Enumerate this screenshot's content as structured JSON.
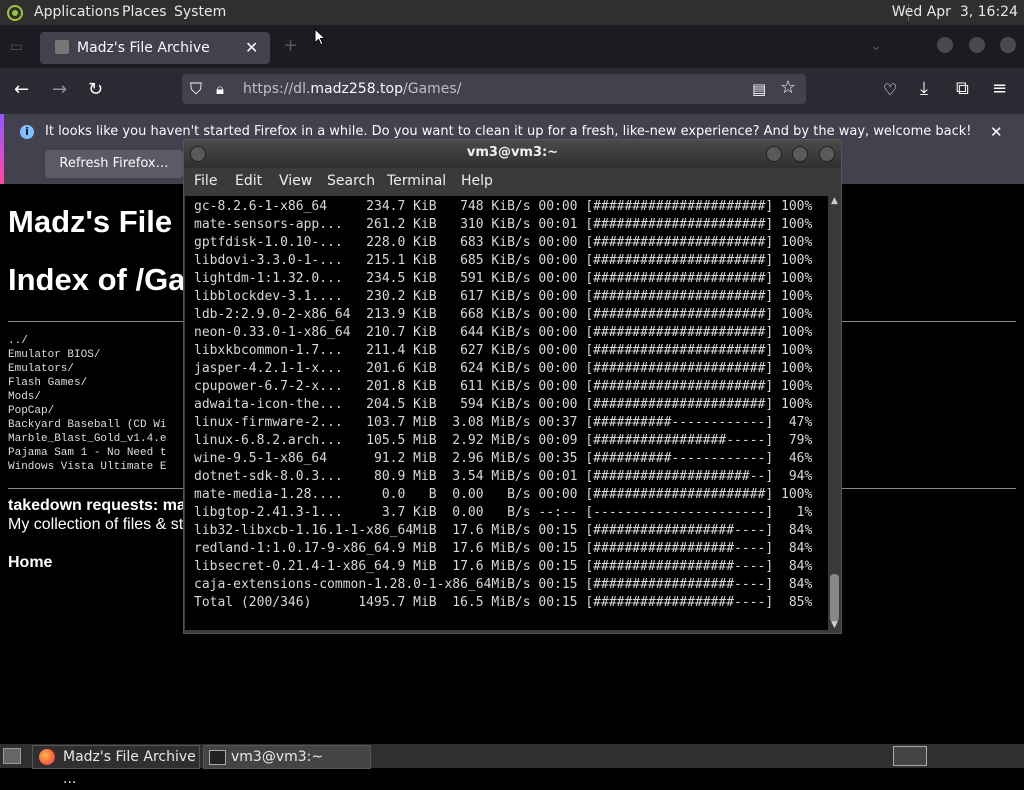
{
  "top_panel": {
    "menus": [
      "Applications",
      "Places",
      "System"
    ],
    "clock": "Wed Apr  3, 16:24"
  },
  "firefox": {
    "tab_title": "Madz's File Archive",
    "url_prefix": "https://dl.",
    "url_domain": "madz258.top",
    "url_path": "/Games/",
    "notification": "It looks like you haven't started Firefox in a while. Do you want to clean it up for a fresh, like-new experience? And by the way, welcome back!",
    "refresh_label": "Refresh Firefox…"
  },
  "page": {
    "title": "Madz's File",
    "index_heading": "Index of /Ga",
    "listing": [
      "../",
      "Emulator BIOS/",
      "Emulators/",
      "Flash Games/",
      "Mods/",
      "PopCap/",
      "Backyard Baseball (CD Wi",
      "Marble_Blast_Gold_v1.4.e",
      "Pajama Sam 1 - No Need t",
      "Windows Vista Ultimate E"
    ],
    "takedown": "takedown requests: ma",
    "collection": "My collection of files & st",
    "home": "Home"
  },
  "terminal": {
    "title": "vm3@vm3:~",
    "menus": [
      "File",
      "Edit",
      "View",
      "Search",
      "Terminal",
      "Help"
    ],
    "lines": [
      "gc-8.2.6-1-x86_64     234.7 KiB   748 KiB/s 00:00 [######################] 100%",
      "mate-sensors-app...   261.2 KiB   310 KiB/s 00:01 [######################] 100%",
      "gptfdisk-1.0.10-...   228.0 KiB   683 KiB/s 00:00 [######################] 100%",
      "libdovi-3.3.0-1-...   215.1 KiB   685 KiB/s 00:00 [######################] 100%",
      "lightdm-1:1.32.0...   234.5 KiB   591 KiB/s 00:00 [######################] 100%",
      "libblockdev-3.1....   230.2 KiB   617 KiB/s 00:00 [######################] 100%",
      "ldb-2:2.9.0-2-x86_64  213.9 KiB   668 KiB/s 00:00 [######################] 100%",
      "neon-0.33.0-1-x86_64  210.7 KiB   644 KiB/s 00:00 [######################] 100%",
      "libxkbcommon-1.7...   211.4 KiB   627 KiB/s 00:00 [######################] 100%",
      "jasper-4.2.1-1-x...   201.6 KiB   624 KiB/s 00:00 [######################] 100%",
      "cpupower-6.7-2-x...   201.8 KiB   611 KiB/s 00:00 [######################] 100%",
      "adwaita-icon-the...   204.5 KiB   594 KiB/s 00:00 [######################] 100%",
      "linux-firmware-2...   103.7 MiB  3.08 MiB/s 00:37 [##########------------]  47%",
      "linux-6.8.2.arch...   105.5 MiB  2.92 MiB/s 00:09 [#################-----]  79%",
      "wine-9.5-1-x86_64      91.2 MiB  2.96 MiB/s 00:35 [##########------------]  46%",
      "dotnet-sdk-8.0.3...    80.9 MiB  3.54 MiB/s 00:01 [####################--]  94%",
      "mate-media-1.28....     0.0   B  0.00   B/s 00:00 [######################] 100%",
      "libgtop-2.41.3-1...     3.7 KiB  0.00   B/s --:-- [----------------------]   1%",
      "lib32-libxcb-1.16.1-1-x86_64MiB  17.6 MiB/s 00:15 [##################----]  84%",
      "redland-1:1.0.17-9-x86_64.9 MiB  17.6 MiB/s 00:15 [##################----]  84%",
      "libsecret-0.21.4-1-x86_64.9 MiB  17.6 MiB/s 00:15 [##################----]  84%",
      "caja-extensions-common-1.28.0-1-x86_64MiB/s 00:15 [##################----]  84%",
      "Total (200/346)      1495.7 MiB  16.5 MiB/s 00:15 [##################----]  85%"
    ]
  },
  "taskbar": {
    "items": [
      "Madz's File Archive ...",
      "vm3@vm3:~"
    ]
  }
}
